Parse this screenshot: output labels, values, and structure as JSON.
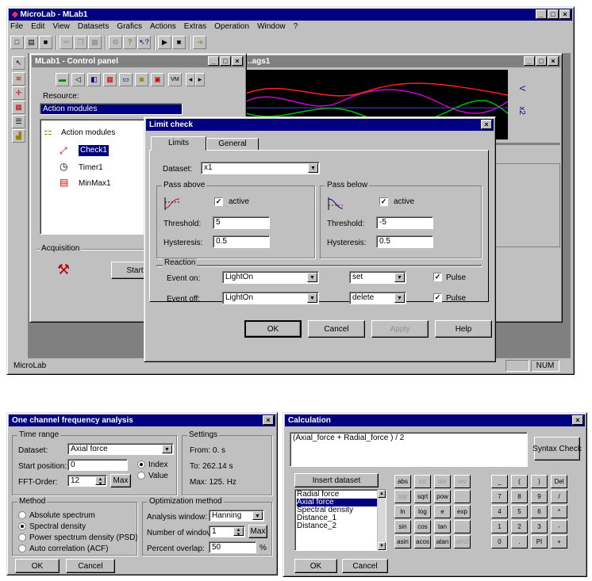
{
  "main_window": {
    "title": "MicroLab - MLab1",
    "menu": [
      "File",
      "Edit",
      "View",
      "Datasets",
      "Grafics",
      "Actions",
      "Extras",
      "Operation",
      "Window",
      "?"
    ],
    "status_text": "MicroLab",
    "status_num": "NUM"
  },
  "control_panel": {
    "title": "MLab1 - Control panel",
    "resource_label": "Resource:",
    "resource_value": "Action modules",
    "tree": [
      "Action modules",
      "Check1",
      "Timer1",
      "MinMax1"
    ],
    "acquisition_label": "Acquisition",
    "start_button": "Start"
  },
  "graph_window": {
    "title": "..ags1",
    "axis_labels": [
      "V",
      "x2",
      "V",
      "x2"
    ]
  },
  "limit_check": {
    "title": "Limit check",
    "tabs": [
      "Limits",
      "General"
    ],
    "dataset_label": "Dataset:",
    "dataset_value": "x1",
    "pass_above": {
      "title": "Pass above",
      "active": "active",
      "threshold_label": "Threshold:",
      "threshold": "5",
      "hysteresis_label": "Hysteresis:",
      "hysteresis": "0.5"
    },
    "pass_below": {
      "title": "Pass below",
      "active": "active",
      "threshold_label": "Threshold:",
      "threshold": "-5",
      "hysteresis_label": "Hysteresis:",
      "hysteresis": "0.5"
    },
    "reaction": {
      "title": "Reaction",
      "event_on_label": "Event on:",
      "event_on": "LightOn",
      "event_on_action": "set",
      "event_off_label": "Event off:",
      "event_off": "LightOn",
      "event_off_action": "delete",
      "pulse": "Pulse"
    },
    "buttons": {
      "ok": "OK",
      "cancel": "Cancel",
      "apply": "Apply",
      "help": "Help"
    }
  },
  "freq_analysis": {
    "title": "One channel frequency analysis",
    "time_range": "Time range",
    "dataset_label": "Dataset:",
    "dataset_value": "Axial force",
    "start_label": "Start position:",
    "start_value": "0",
    "fft_label": "FFT-Order:",
    "fft_value": "12",
    "max_button": "Max",
    "index_label": "Index",
    "value_label": "Value",
    "settings_title": "Settings",
    "from": "From: 0. s",
    "to": "To:  262.14 s",
    "max_freq": "Max:  125. Hz",
    "method_title": "Method",
    "methods": [
      "Absolute spectrum",
      "Spectral density",
      "Power spectrum density (PSD)",
      "Auto correlation (ACF)"
    ],
    "opt_title": "Optimization method",
    "window_label": "Analysis window:",
    "window_value": "Hanning",
    "num_windows_label": "Number of windows:",
    "num_windows_value": "1",
    "max2_button": "Max",
    "overlap_label": "Percent overlap:",
    "overlap_value": "50",
    "overlap_unit": "%",
    "ok": "OK",
    "cancel": "Cancel"
  },
  "calculation": {
    "title": "Calculation",
    "expression": "(Axial_force + Radial_force ) / 2",
    "syntax_check": "Syntax Check",
    "insert_dataset": "Insert dataset",
    "datasets": [
      "Radial force",
      "Axial force",
      "Spectral density",
      "Distance_1",
      "Distance_2"
    ],
    "func_keys": [
      [
        "abs",
        "int",
        "der",
        "rev"
      ],
      [
        "sqr",
        "sqrt",
        "pow",
        ""
      ],
      [
        "ln",
        "log",
        "e",
        "exp"
      ],
      [
        "sin",
        "cos",
        "tan",
        ""
      ],
      [
        "asin",
        "acos",
        "atan",
        "atn2"
      ]
    ],
    "num_keys": [
      [
        "_",
        "(",
        ")",
        "Del"
      ],
      [
        "7",
        "8",
        "9",
        "/"
      ],
      [
        "4",
        "5",
        "6",
        "*"
      ],
      [
        "1",
        "2",
        "3",
        "-"
      ],
      [
        "0",
        ".",
        "PI",
        "+"
      ]
    ],
    "ok": "OK",
    "cancel": "Cancel"
  },
  "colors": {
    "titlebar": "#000080",
    "inactive_titlebar": "#808080",
    "face": "#c0c0c0",
    "workspace": "#808080",
    "selection": "#000080"
  }
}
